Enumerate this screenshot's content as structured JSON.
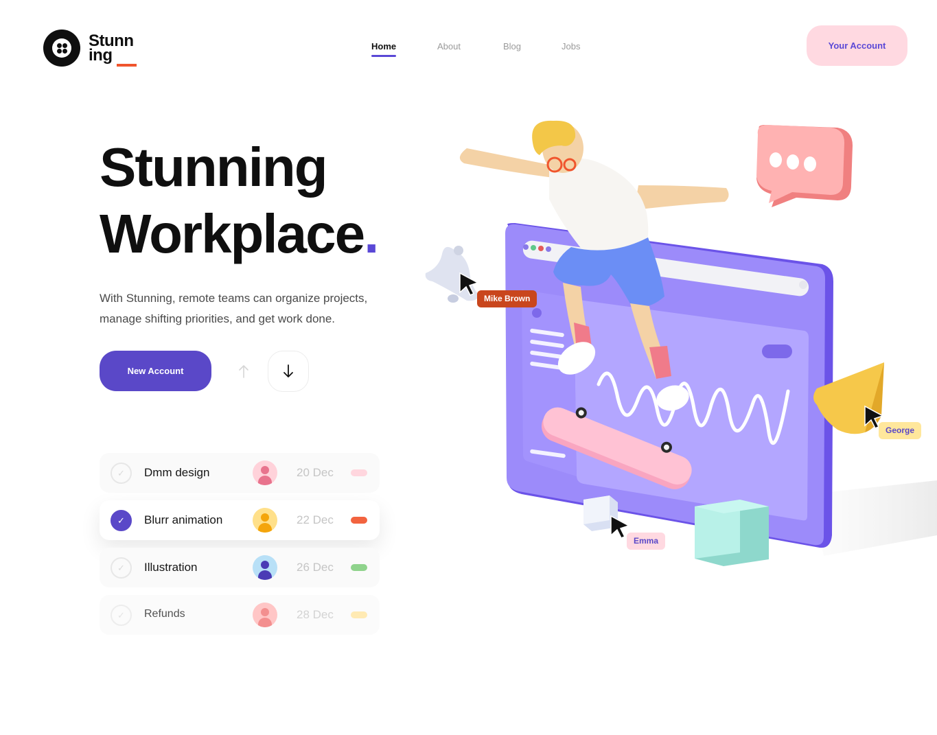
{
  "brand": {
    "line1": "Stunn",
    "line2": "ing"
  },
  "nav": {
    "items": [
      {
        "label": "Home",
        "active": true
      },
      {
        "label": "About",
        "active": false
      },
      {
        "label": "Blog",
        "active": false
      },
      {
        "label": "Jobs",
        "active": false
      }
    ]
  },
  "account_button": "Your Account",
  "hero": {
    "title_line1": "Stunning",
    "title_line2": "Workplace",
    "title_dot": ".",
    "description": "With Stunning, remote teams can organize projects, manage shifting priorities, and get work done."
  },
  "actions": {
    "new_account": "New Account",
    "up_icon": "arrow-up-icon",
    "down_icon": "arrow-down-icon"
  },
  "tasks": [
    {
      "name": "Dmm design",
      "date": "20 Dec",
      "checked": false,
      "avatar_color": "#f9a8b8",
      "pill_color": "#ffd6de"
    },
    {
      "name": "Blurr animation",
      "date": "22 Dec",
      "checked": true,
      "avatar_color": "#ffd36b",
      "pill_color": "#f2633f"
    },
    {
      "name": "Illustration",
      "date": "26 Dec",
      "checked": false,
      "avatar_color": "#a9d8f5",
      "pill_color": "#8fd38c"
    },
    {
      "name": "Refunds",
      "date": "28 Dec",
      "checked": false,
      "avatar_color": "#f99e9e",
      "pill_color": "#ffe49a"
    }
  ],
  "cursors": [
    {
      "name": "Mike Brown",
      "bg": "#c9461d",
      "fg": "#ffffff"
    },
    {
      "name": "George",
      "bg": "#ffe79c",
      "fg": "#5a48c8"
    },
    {
      "name": "Emma",
      "bg": "#ffd9e1",
      "fg": "#5a48c8"
    }
  ],
  "colors": {
    "accent": "#5a48c8",
    "brand_bar": "#f0552d",
    "account_bg": "#ffd9e1"
  }
}
